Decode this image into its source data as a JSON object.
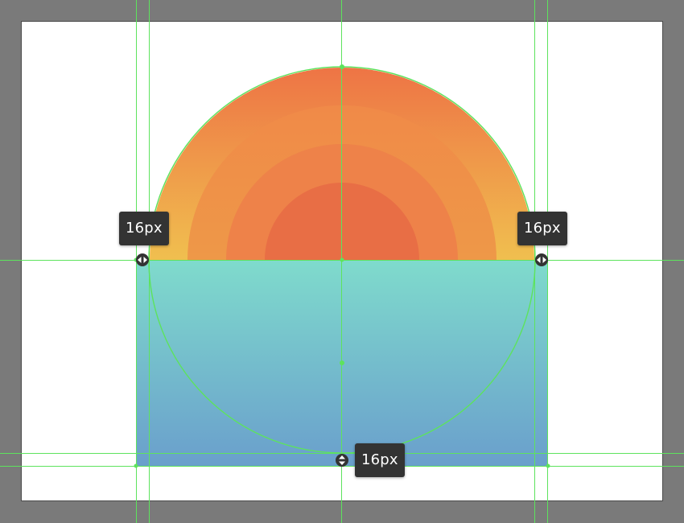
{
  "measurements": {
    "left_gap": "16px",
    "right_gap": "16px",
    "bottom_gap": "16px"
  },
  "colors": {
    "canvas_background": "#7a7a7a",
    "artboard": "#ffffff",
    "guide_line": "#5de35d",
    "sun_outer_top": "#ee7445",
    "sun_outer_bottom": "#f0bf4f",
    "sun_ring_2": "#ef8648",
    "sun_ring_3": "#ee8249",
    "sun_core": "#e86e45",
    "water_top": "#7fdbcc",
    "water_bottom": "#6a9fcc",
    "tooltip_bg": "#333333",
    "tooltip_text": "#ffffff"
  },
  "icons": {
    "horizontal_anchor": "horizontal-resize-handle-icon",
    "vertical_anchor": "vertical-resize-handle-icon"
  }
}
